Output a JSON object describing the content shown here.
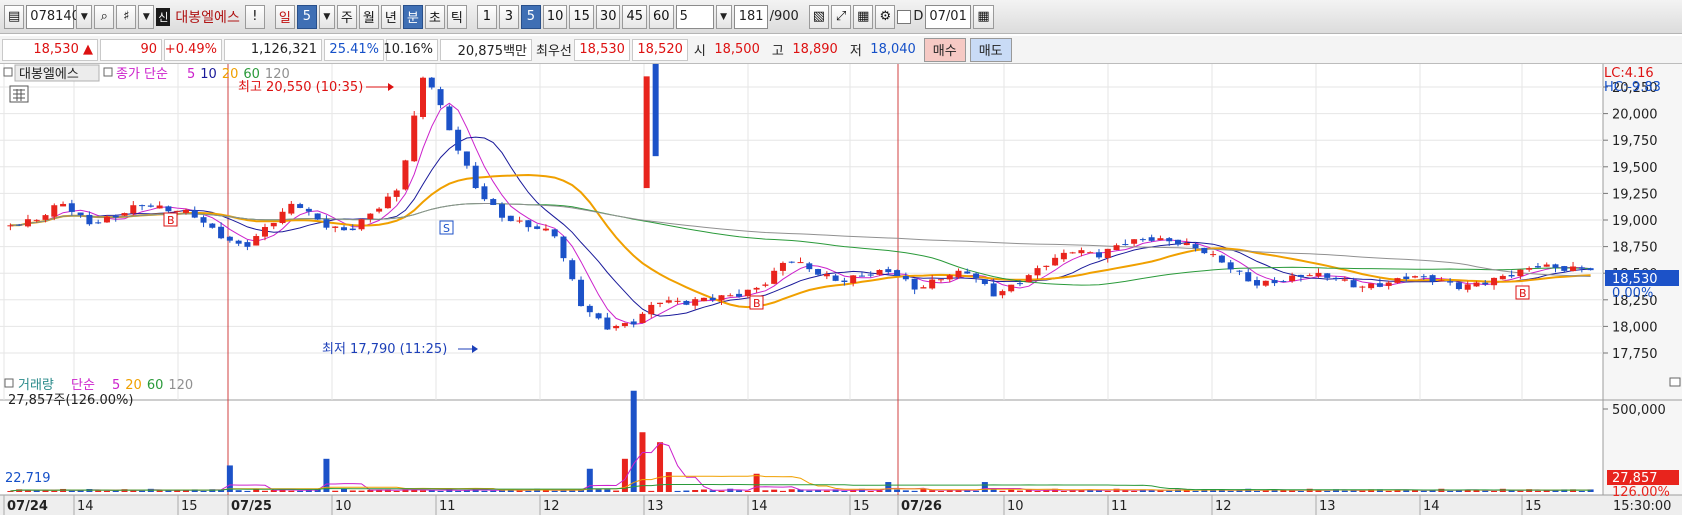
{
  "toolbar": {
    "code": "078140",
    "new_badge": "신",
    "stock_name": "대봉엘에스",
    "alert": "!",
    "day_label": "일",
    "day_count": "5",
    "week": "주",
    "month": "월",
    "year": "년",
    "minute": "분",
    "second": "초",
    "tick": "틱",
    "intervals": [
      "1",
      "3",
      "5",
      "10",
      "15",
      "30",
      "45",
      "60"
    ],
    "selected_interval": "5",
    "interval_value": "5",
    "count": "181",
    "count_total": "/900",
    "date_check_label": "D",
    "date": "07/01"
  },
  "quote": {
    "price": "18,530",
    "arrow": "▲",
    "change": "90",
    "change_pct": "+0.49%",
    "volume": "1,126,321",
    "vol_ratio": "25.41%",
    "turnover": "10.16%",
    "amount": "20,875백만",
    "best_label": "최우선",
    "ask": "18,530",
    "bid": "18,520",
    "open_label": "시",
    "open": "18,500",
    "high_label": "고",
    "high": "18,890",
    "low_label": "저",
    "low": "18,040",
    "buy_label": "매수",
    "sell_label": "매도"
  },
  "price_legend": {
    "name": "대봉엘에스",
    "indicator": "종가 단순",
    "ma": [
      "5",
      "10",
      "20",
      "60",
      "120"
    ],
    "ma_colors": [
      "#cc22cc",
      "#1a1a9a",
      "#f0a000",
      "#2a9a3a",
      "#909090"
    ]
  },
  "annotations": {
    "high": "최고 20,550 (10:35)",
    "low": "최저 17,790 (11:25)",
    "lc": "LC:4.16",
    "hc": "HC:-9.83",
    "current_price": "18,530",
    "current_pct": "0.00%"
  },
  "price_axis": [
    "20,250",
    "20,000",
    "19,750",
    "19,500",
    "19,250",
    "19,000",
    "18,750",
    "18,500",
    "18,250",
    "18,000",
    "17,750"
  ],
  "volume_legend": {
    "title": "거래량",
    "indicator": "단순",
    "ma": [
      "5",
      "20",
      "60",
      "120"
    ],
    "value_text": "27,857주(126.00%)",
    "left_value": "22,719"
  },
  "volume_axis": {
    "tick": "500,000",
    "current": "27,857",
    "current_pct": "126.00%"
  },
  "time_axis": {
    "labels": [
      "07/24",
      "14",
      "15",
      "07/25",
      "10",
      "11",
      "12",
      "13",
      "14",
      "15",
      "07/26",
      "10",
      "11",
      "12",
      "13",
      "14",
      "15"
    ],
    "bold": [
      "07/24",
      "07/25",
      "07/26"
    ],
    "time": "15:30:00"
  },
  "chart_data": {
    "type": "candlestick",
    "price_range": [
      17600,
      20550
    ],
    "volume_range": [
      0,
      700000
    ],
    "colors": {
      "up": "#e8241d",
      "down": "#1c52c8",
      "ma5": "#cc22cc",
      "ma10": "#1a1a9a",
      "ma20": "#f0a000",
      "ma60": "#2a9a3a",
      "ma120": "#909090"
    },
    "key_points": [
      18950,
      18980,
      19150,
      18980,
      19050,
      19150,
      19080,
      19050,
      18880,
      18760,
      18960,
      19150,
      18950,
      18900,
      19100,
      19300,
      20400,
      19800,
      19300,
      19050,
      18950,
      18850,
      18200,
      18000,
      18050,
      18250,
      18200,
      18250,
      18300,
      18400,
      18650,
      18500,
      18400,
      18500,
      18550,
      18350,
      18450,
      18500,
      18300,
      18450,
      18600,
      18700,
      18650,
      18800,
      18850,
      18800,
      18700,
      18550,
      18400,
      18450,
      18500,
      18450,
      18350,
      18400,
      18500,
      18450,
      18350,
      18400,
      18500,
      18600,
      18550,
      18530
    ]
  }
}
